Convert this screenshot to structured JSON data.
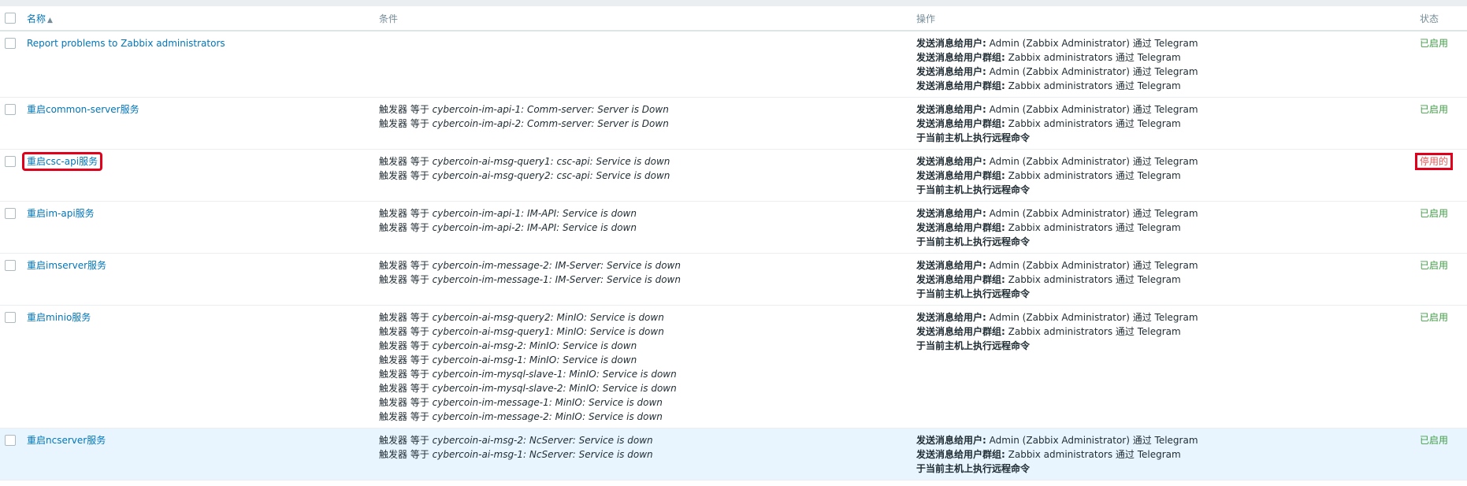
{
  "header": {
    "name_label": "名称",
    "sort_indicator": "▲",
    "conditions_label": "条件",
    "operations_label": "操作",
    "status_label": "状态"
  },
  "rows": [
    {
      "name": "Report problems to Zabbix administrators",
      "conditions": [],
      "operations": [
        {
          "label": "发送消息给用户:",
          "text": " Admin (Zabbix Administrator) 通过 Telegram"
        },
        {
          "label": "发送消息给用户群组:",
          "text": " Zabbix administrators 通过 Telegram"
        },
        {
          "label": "发送消息给用户:",
          "text": " Admin (Zabbix Administrator) 通过 Telegram"
        },
        {
          "label": "发送消息给用户群组:",
          "text": " Zabbix administrators 通过 Telegram"
        }
      ],
      "status": "已启用",
      "enabled": true
    },
    {
      "name": "重启common-server服务",
      "conditions": [
        {
          "prefix": "触发器 等于 ",
          "value": "cybercoin-im-api-1: Comm-server: Server is Down"
        },
        {
          "prefix": "触发器 等于 ",
          "value": "cybercoin-im-api-2: Comm-server: Server is Down"
        }
      ],
      "operations": [
        {
          "label": "发送消息给用户:",
          "text": " Admin (Zabbix Administrator) 通过 Telegram"
        },
        {
          "label": "发送消息给用户群组:",
          "text": " Zabbix administrators 通过 Telegram"
        },
        {
          "label": "于当前主机上执行远程命令",
          "text": ""
        }
      ],
      "status": "已启用",
      "enabled": true
    },
    {
      "name": "重启csc-api服务",
      "conditions": [
        {
          "prefix": "触发器 等于 ",
          "value": "cybercoin-ai-msg-query1: csc-api: Service is down"
        },
        {
          "prefix": "触发器 等于 ",
          "value": "cybercoin-ai-msg-query2: csc-api: Service is down"
        }
      ],
      "operations": [
        {
          "label": "发送消息给用户:",
          "text": " Admin (Zabbix Administrator) 通过 Telegram"
        },
        {
          "label": "发送消息给用户群组:",
          "text": " Zabbix administrators 通过 Telegram"
        },
        {
          "label": "于当前主机上执行远程命令",
          "text": ""
        }
      ],
      "status": "停用的",
      "enabled": false
    },
    {
      "name": "重启im-api服务",
      "conditions": [
        {
          "prefix": "触发器 等于 ",
          "value": "cybercoin-im-api-1: IM-API: Service is down"
        },
        {
          "prefix": "触发器 等于 ",
          "value": "cybercoin-im-api-2: IM-API: Service is down"
        }
      ],
      "operations": [
        {
          "label": "发送消息给用户:",
          "text": " Admin (Zabbix Administrator) 通过 Telegram"
        },
        {
          "label": "发送消息给用户群组:",
          "text": " Zabbix administrators 通过 Telegram"
        },
        {
          "label": "于当前主机上执行远程命令",
          "text": ""
        }
      ],
      "status": "已启用",
      "enabled": true
    },
    {
      "name": "重启imserver服务",
      "conditions": [
        {
          "prefix": "触发器 等于 ",
          "value": "cybercoin-im-message-2: IM-Server: Service is down"
        },
        {
          "prefix": "触发器 等于 ",
          "value": "cybercoin-im-message-1: IM-Server: Service is down"
        }
      ],
      "operations": [
        {
          "label": "发送消息给用户:",
          "text": " Admin (Zabbix Administrator) 通过 Telegram"
        },
        {
          "label": "发送消息给用户群组:",
          "text": " Zabbix administrators 通过 Telegram"
        },
        {
          "label": "于当前主机上执行远程命令",
          "text": ""
        }
      ],
      "status": "已启用",
      "enabled": true
    },
    {
      "name": "重启minio服务",
      "conditions": [
        {
          "prefix": "触发器 等于 ",
          "value": "cybercoin-ai-msg-query2: MinIO: Service is down"
        },
        {
          "prefix": "触发器 等于 ",
          "value": "cybercoin-ai-msg-query1: MinIO: Service is down"
        },
        {
          "prefix": "触发器 等于 ",
          "value": "cybercoin-ai-msg-2: MinIO: Service is down"
        },
        {
          "prefix": "触发器 等于 ",
          "value": "cybercoin-ai-msg-1: MinIO: Service is down"
        },
        {
          "prefix": "触发器 等于 ",
          "value": "cybercoin-im-mysql-slave-1: MinIO: Service is down"
        },
        {
          "prefix": "触发器 等于 ",
          "value": "cybercoin-im-mysql-slave-2: MinIO: Service is down"
        },
        {
          "prefix": "触发器 等于 ",
          "value": "cybercoin-im-message-1: MinIO: Service is down"
        },
        {
          "prefix": "触发器 等于 ",
          "value": "cybercoin-im-message-2: MinIO: Service is down"
        }
      ],
      "operations": [
        {
          "label": "发送消息给用户:",
          "text": " Admin (Zabbix Administrator) 通过 Telegram"
        },
        {
          "label": "发送消息给用户群组:",
          "text": " Zabbix administrators 通过 Telegram"
        },
        {
          "label": "于当前主机上执行远程命令",
          "text": ""
        }
      ],
      "status": "已启用",
      "enabled": true
    },
    {
      "name": "重启ncserver服务",
      "conditions": [
        {
          "prefix": "触发器 等于 ",
          "value": "cybercoin-ai-msg-2: NcServer: Service is down"
        },
        {
          "prefix": "触发器 等于 ",
          "value": "cybercoin-ai-msg-1: NcServer: Service is down"
        }
      ],
      "operations": [
        {
          "label": "发送消息给用户:",
          "text": " Admin (Zabbix Administrator) 通过 Telegram"
        },
        {
          "label": "发送消息给用户群组:",
          "text": " Zabbix administrators 通过 Telegram"
        },
        {
          "label": "于当前主机上执行远程命令",
          "text": ""
        }
      ],
      "status": "已启用",
      "enabled": true
    }
  ]
}
